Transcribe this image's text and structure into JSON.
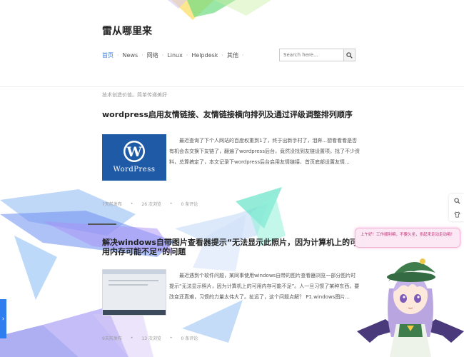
{
  "site": {
    "title": "雷从哪里来",
    "tagline": "技术创造价值。简单传递美好"
  },
  "nav": {
    "items": [
      {
        "label": "首页",
        "active": true
      },
      {
        "label": "News",
        "active": false
      },
      {
        "label": "网络",
        "active": false
      },
      {
        "label": "Linux",
        "active": false
      },
      {
        "label": "Helpdesk",
        "active": false
      },
      {
        "label": "其他",
        "active": false
      }
    ],
    "separator": "·"
  },
  "search": {
    "placeholder": "Search here..."
  },
  "posts": [
    {
      "title": "wordpress启用友情链接、友情链接横向排列及通过评级调整排列顺序",
      "thumb_text": "WordPress",
      "excerpt": "最近查询了下个人网站的百度权重到1了，终于出新手村了，泪奔...想看看看是否有机会去交换下友链了，翻遍了wordpress后台，竟然没找到友链设置项。找了不少资料，总算搞定了，本文记录下wordpress后台启用友情链接、首页底部设置友情...",
      "meta": {
        "posted": "7天前发布",
        "views": "26 次浏览",
        "comments": "0 条评论"
      }
    },
    {
      "title": "解决windows自带图片查看器提示“无法显示此照片，因为计算机上的可用内存可能不足”的问题",
      "excerpt": "最近遇到个软件问题，某同事使用windows自带的图片查看器浏览一部分图片时提示“无法显示照片，因为计算机上的可用内存可能不足”。人一旦习惯了某种东西，要改变还真难，习惯的力量太伟大了。扯远了，这个问题点解？ P1.windows图片...",
      "meta": {
        "posted": "9天前发布",
        "views": "13 次浏览",
        "comments": "0 条评论"
      }
    }
  ],
  "widget": {
    "greeting": "上午好！工作顺利嘛，不要久坐，多起来走动走动哦！"
  },
  "colors": {
    "accent": "#3a7bd5",
    "side_tab": "#2f7ef0"
  }
}
